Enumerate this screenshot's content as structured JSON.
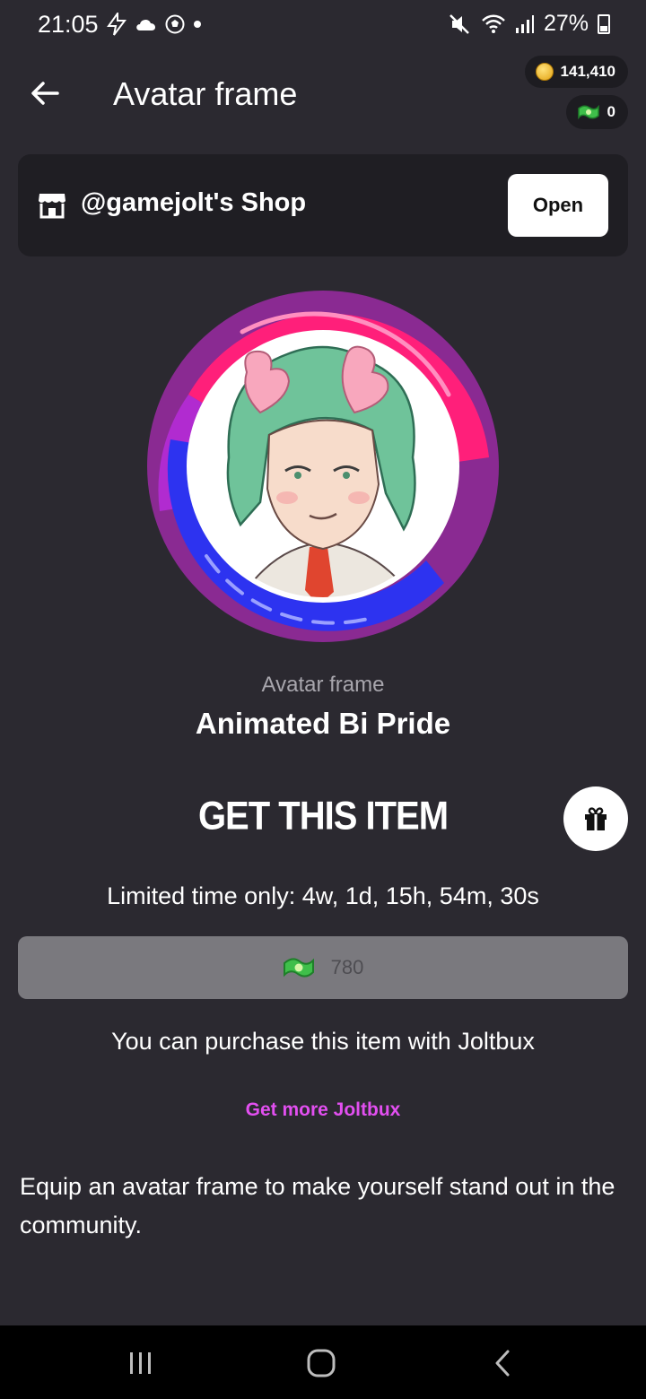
{
  "status_bar": {
    "time": "21:05",
    "battery": "27%"
  },
  "header": {
    "title": "Avatar frame",
    "coins": "141,410",
    "joltbux": "0"
  },
  "shop": {
    "name": "@gamejolt's Shop",
    "open_label": "Open"
  },
  "item": {
    "type": "Avatar frame",
    "name": "Animated Bi Pride"
  },
  "purchase": {
    "heading": "GET THIS ITEM",
    "limited": "Limited time only: 4w, 1d, 15h, 54m, 30s",
    "price": "780",
    "info": "You can purchase this item with Joltbux",
    "more_link": "Get more Joltbux"
  },
  "description": "Equip an avatar frame to make yourself stand out in the community.",
  "icons": {
    "back": "back-arrow-icon",
    "shop": "shop-icon",
    "gift": "gift-icon",
    "coin": "coin-icon",
    "joltbux": "joltbux-icon"
  },
  "colors": {
    "background": "#2b2930",
    "card": "#1f1e23",
    "accent_link": "#e24ff0",
    "pride_pink": "#ff1f7a",
    "pride_purple": "#a62fb8",
    "pride_blue": "#2d33f0"
  }
}
